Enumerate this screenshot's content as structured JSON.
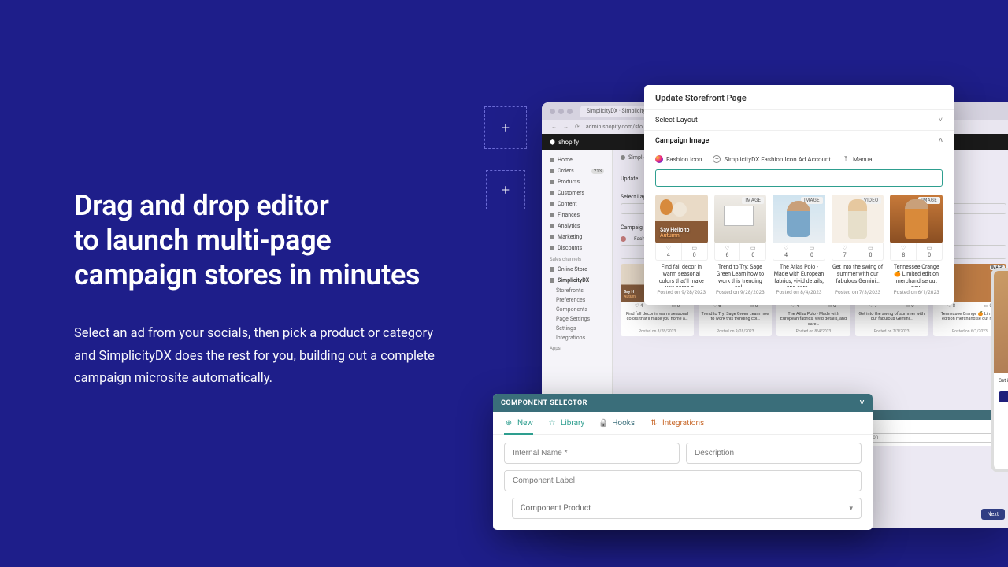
{
  "hero": {
    "headline_l1": "Drag and drop editor",
    "headline_l2": "to launch multi-page",
    "headline_l3": "campaign stores in minutes",
    "body": "Select an ad from your socials, then pick a product or category and SimplicityDX does the rest for you, building out a complete campaign microsite automatically."
  },
  "browser": {
    "tab_title": "SimplicityDX · SimplicityDX · Sh",
    "url": "admin.shopify.com/sto",
    "shopify_label": "shopify",
    "sidebar": {
      "items": [
        "Home",
        "Orders",
        "Products",
        "Customers",
        "Content",
        "Finances",
        "Analytics",
        "Marketing",
        "Discounts"
      ],
      "orders_badge": "213",
      "channels_label": "Sales channels",
      "channels": [
        "Online Store",
        "SimplicityDX"
      ],
      "sdx_sub": [
        "Storefronts",
        "Preferences",
        "Components",
        "Page Settings",
        "Settings",
        "Integrations"
      ],
      "apps_label": "Apps"
    },
    "main": {
      "crumb": "SimplicityDX",
      "update_label": "Update",
      "select_layout": "Select Lay",
      "campaign": "Campaig",
      "acct": "Fashio",
      "next": "Next"
    }
  },
  "modal": {
    "title": "Update Storefront Page",
    "select_layout": "Select Layout",
    "campaign_image": "Campaign Image",
    "accounts": {
      "ig": "Fashion Icon",
      "ad": "SimplicityDX Fashion Icon Ad Account",
      "manual": "Manual"
    },
    "search_placeholder": "",
    "cards": [
      {
        "tag": "",
        "likes": "4",
        "comments": "0",
        "caption": "Find fall decor in warm seasonal colors that'll make you home a…",
        "date": "Posted on 9/28/2023",
        "ovr1": "Say Hello to",
        "ovr2": "Autumn"
      },
      {
        "tag": "IMAGE",
        "likes": "6",
        "comments": "0",
        "caption": "Trend to Try: Sage Green Learn how to work this trending col…",
        "date": "Posted on 9/28/2023"
      },
      {
        "tag": "IMAGE",
        "likes": "4",
        "comments": "0",
        "caption": "The Atlas Polo - Made with European fabrics, vivid details, and care…",
        "date": "Posted on 8/4/2023"
      },
      {
        "tag": "VIDEO",
        "likes": "7",
        "comments": "0",
        "caption": "Get into the swing of summer with our fabulous Gemini…",
        "date": "Posted on 7/3/2023"
      },
      {
        "tag": "IMAGE",
        "likes": "8",
        "comments": "0",
        "caption": "Tennessee Orange 🍊 Limited edition merchandise out now",
        "date": "Posted on 6/1/2023"
      }
    ],
    "bg_cards": [
      {
        "caption": "Find fall decor in warm seasonal colors that'll make you home a…",
        "date": "Posted on 8/28/2023",
        "ovr1": "Say H",
        "ovr2": "Autum"
      },
      {
        "caption": "Trend to Try: Sage Green Learn how to work this trending col…",
        "date": "Posted on 9/28/2023"
      },
      {
        "caption": "The Atlas Polo - Made with European fabrics, vivid details, and care…",
        "date": "Posted on 8/4/2023"
      },
      {
        "caption": "Get into the swing of summer with our fabulous Gemini…",
        "date": "Posted on 7/3/2023"
      },
      {
        "caption": "Tennessee Orange 🍊 Limited edition merchandise out now",
        "date": "Posted on 6/1/2023"
      }
    ]
  },
  "compsel": {
    "heading": "COMPONENT SELECTOR",
    "tabs": {
      "new": "New",
      "library": "Library",
      "hooks": "Hooks",
      "integrations": "Integrations"
    },
    "fields": {
      "internal_name": "Internal Name *",
      "description": "Description",
      "component_label": "Component Label",
      "component_product": "Component Product"
    }
  },
  "phone": {
    "cta": "Get into the swi"
  }
}
